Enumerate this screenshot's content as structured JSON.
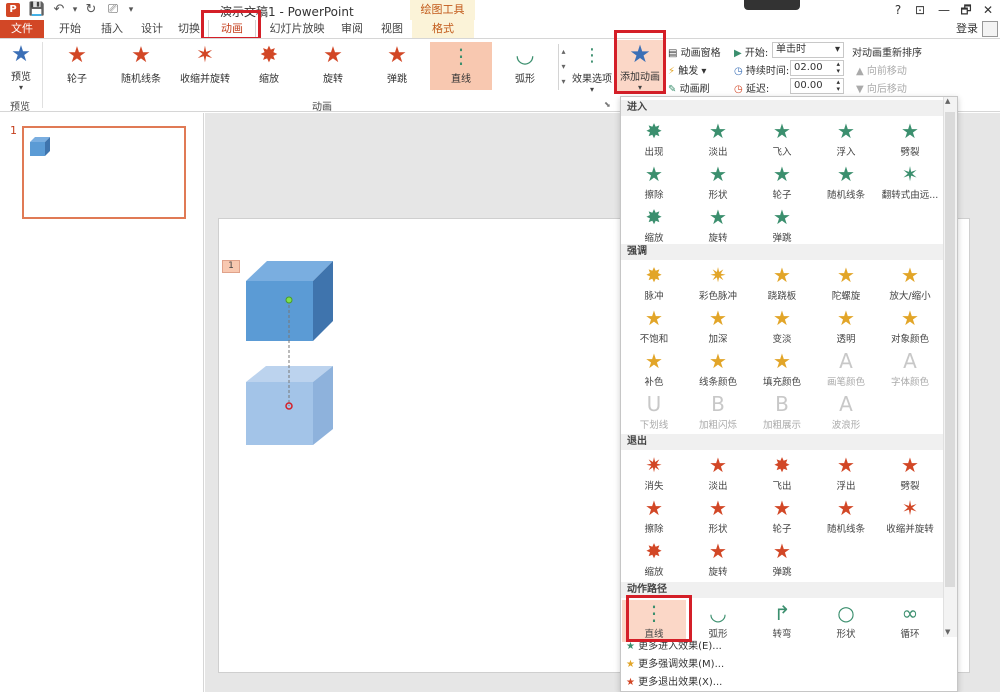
{
  "window": {
    "title": "演示文稿1 - PowerPoint",
    "app_icon": "P",
    "context_tools": "绘图工具",
    "controls": [
      "?",
      "⊡",
      "—",
      "🗗",
      "✕"
    ]
  },
  "tabs": [
    "文件",
    "开始",
    "插入",
    "设计",
    "切换",
    "动画",
    "幻灯片放映",
    "审阅",
    "视图",
    "格式"
  ],
  "login": "登录",
  "ribbon": {
    "preview_label": "预览",
    "preview_group": "预览",
    "animation_group": "动画",
    "gallery": [
      "轮子",
      "随机线条",
      "收缩并旋转",
      "缩放",
      "旋转",
      "弹跳",
      "直线",
      "弧形"
    ],
    "effect_options": "效果选项",
    "add_animation": "添加动画",
    "animation_pane": "动画窗格",
    "trigger": "触发",
    "painter": "动画刷",
    "start_label": "开始:",
    "start_value": "单击时",
    "duration_label": "持续时间:",
    "duration_value": "02.00",
    "delay_label": "延迟:",
    "delay_value": "00.00",
    "reorder_label": "对动画重新排序",
    "move_earlier": "向前移动",
    "move_later": "向后移动"
  },
  "slides": {
    "thumb_number": "1",
    "anim_tag": "1"
  },
  "dropdown": {
    "sections": [
      {
        "title": "进入",
        "color": "#3b8f6e",
        "items": [
          {
            "label": "出现",
            "disabled": false
          },
          {
            "label": "淡出",
            "disabled": false
          },
          {
            "label": "飞入",
            "disabled": false
          },
          {
            "label": "浮入",
            "disabled": false
          },
          {
            "label": "劈裂",
            "disabled": false
          },
          {
            "label": "擦除",
            "disabled": false
          },
          {
            "label": "形状",
            "disabled": false
          },
          {
            "label": "轮子",
            "disabled": false
          },
          {
            "label": "随机线条",
            "disabled": false
          },
          {
            "label": "翻转式由远...",
            "disabled": false
          },
          {
            "label": "缩放",
            "disabled": false
          },
          {
            "label": "旋转",
            "disabled": false
          },
          {
            "label": "弹跳",
            "disabled": false
          }
        ]
      },
      {
        "title": "强调",
        "color": "#e2a528",
        "items": [
          {
            "label": "脉冲",
            "disabled": false
          },
          {
            "label": "彩色脉冲",
            "disabled": false
          },
          {
            "label": "跷跷板",
            "disabled": false
          },
          {
            "label": "陀螺旋",
            "disabled": false
          },
          {
            "label": "放大/缩小",
            "disabled": false
          },
          {
            "label": "不饱和",
            "disabled": false
          },
          {
            "label": "加深",
            "disabled": false
          },
          {
            "label": "变淡",
            "disabled": false
          },
          {
            "label": "透明",
            "disabled": false
          },
          {
            "label": "对象颜色",
            "disabled": false
          },
          {
            "label": "补色",
            "disabled": false
          },
          {
            "label": "线条颜色",
            "disabled": false
          },
          {
            "label": "填充颜色",
            "disabled": false
          },
          {
            "label": "画笔颜色",
            "disabled": true
          },
          {
            "label": "字体颜色",
            "disabled": true
          },
          {
            "label": "下划线",
            "disabled": true
          },
          {
            "label": "加粗闪烁",
            "disabled": true
          },
          {
            "label": "加粗展示",
            "disabled": true
          },
          {
            "label": "波浪形",
            "disabled": true
          }
        ]
      },
      {
        "title": "退出",
        "color": "#d24726",
        "items": [
          {
            "label": "消失",
            "disabled": false
          },
          {
            "label": "淡出",
            "disabled": false
          },
          {
            "label": "飞出",
            "disabled": false
          },
          {
            "label": "浮出",
            "disabled": false
          },
          {
            "label": "劈裂",
            "disabled": false
          },
          {
            "label": "擦除",
            "disabled": false
          },
          {
            "label": "形状",
            "disabled": false
          },
          {
            "label": "轮子",
            "disabled": false
          },
          {
            "label": "随机线条",
            "disabled": false
          },
          {
            "label": "收缩并旋转",
            "disabled": false
          },
          {
            "label": "缩放",
            "disabled": false
          },
          {
            "label": "旋转",
            "disabled": false
          },
          {
            "label": "弹跳",
            "disabled": false
          }
        ]
      },
      {
        "title": "动作路径",
        "color": "#3b8f6e",
        "items": [
          {
            "label": "直线",
            "disabled": false
          },
          {
            "label": "弧形",
            "disabled": false
          },
          {
            "label": "转弯",
            "disabled": false
          },
          {
            "label": "形状",
            "disabled": false
          },
          {
            "label": "循环",
            "disabled": false
          }
        ]
      }
    ],
    "more": [
      {
        "label": "更多进入效果(E)...",
        "color": "#3b8f6e"
      },
      {
        "label": "更多强调效果(M)...",
        "color": "#e2a528"
      },
      {
        "label": "更多退出效果(X)...",
        "color": "#d24726"
      }
    ]
  },
  "colors": {
    "accent": "#d24726",
    "highlight": "#d41f28",
    "cube": "#5b9bd5"
  }
}
